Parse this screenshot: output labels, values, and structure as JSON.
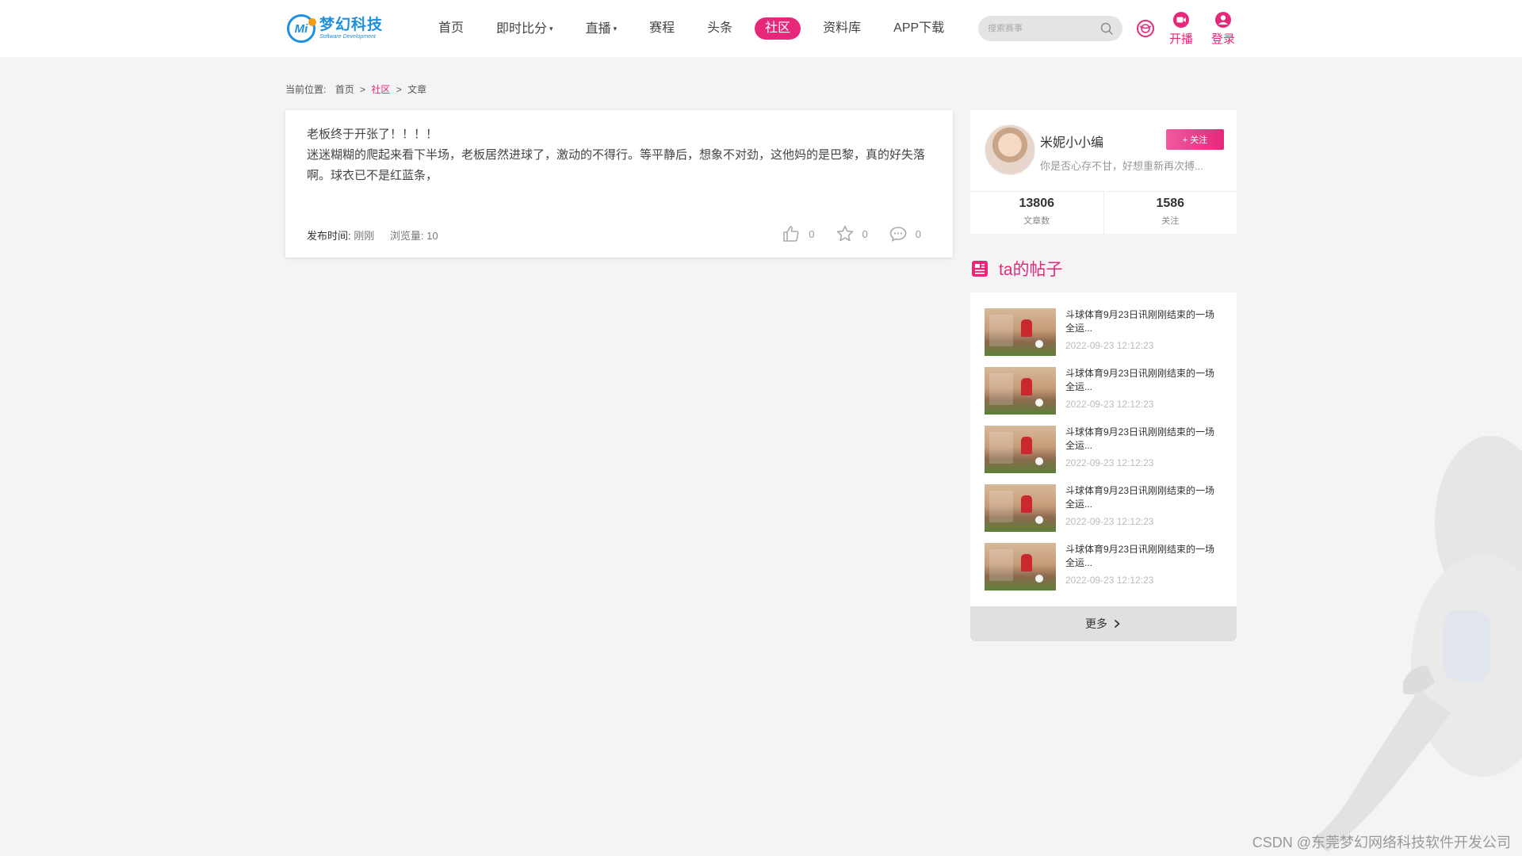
{
  "header": {
    "logo_cn": "梦幻科技",
    "logo_en": "Software Development",
    "logo_mark": "Mi",
    "nav": [
      {
        "label": "首页"
      },
      {
        "label": "即时比分",
        "caret": "▾"
      },
      {
        "label": "直播",
        "caret": "▾"
      },
      {
        "label": "赛程"
      },
      {
        "label": "头条"
      },
      {
        "label": "社区"
      },
      {
        "label": "资料库"
      },
      {
        "label": "APP下载"
      }
    ],
    "search_placeholder": "搜索赛事",
    "broadcast_label": "开播",
    "login_label": "登录"
  },
  "breadcrumb": {
    "prefix": "当前位置:",
    "home": "首页",
    "sep": ">",
    "section": "社区",
    "current": "文章"
  },
  "article": {
    "title": "老板终于开张了！！！！",
    "body": "迷迷糊糊的爬起来看下半场，老板居然进球了，激动的不得行。等平静后，想象不对劲，这他妈的是巴黎，真的好失落啊。球衣已不是红蓝条，",
    "publish_label": "发布时间:",
    "publish_value": "刚刚",
    "views_label": "浏览量:",
    "views_value": "10",
    "likes": "0",
    "favorites": "0",
    "comments": "0"
  },
  "profile": {
    "name": "米妮小小编",
    "bio": "你是否心存不甘，好想重新再次搏...",
    "follow_label": "+ 关注",
    "articles_count": "13806",
    "articles_label": "文章数",
    "following_count": "1586",
    "following_label": "关注"
  },
  "posts": {
    "heading": "ta的帖子",
    "items": [
      {
        "title": "斗球体育9月23日讯刚刚结束的一场全运...",
        "date": "2022-09-23 12:12:23"
      },
      {
        "title": "斗球体育9月23日讯刚刚结束的一场全运...",
        "date": "2022-09-23 12:12:23"
      },
      {
        "title": "斗球体育9月23日讯刚刚结束的一场全运...",
        "date": "2022-09-23 12:12:23"
      },
      {
        "title": "斗球体育9月23日讯刚刚结束的一场全运...",
        "date": "2022-09-23 12:12:23"
      },
      {
        "title": "斗球体育9月23日讯刚刚结束的一场全运...",
        "date": "2022-09-23 12:12:23"
      }
    ],
    "more_label": "更多"
  },
  "watermark": "CSDN @东莞梦幻网络科技软件开发公司",
  "colors": {
    "accent": "#e5287a",
    "brand": "#1f8fe0",
    "page_bg": "#f4f4f4"
  }
}
